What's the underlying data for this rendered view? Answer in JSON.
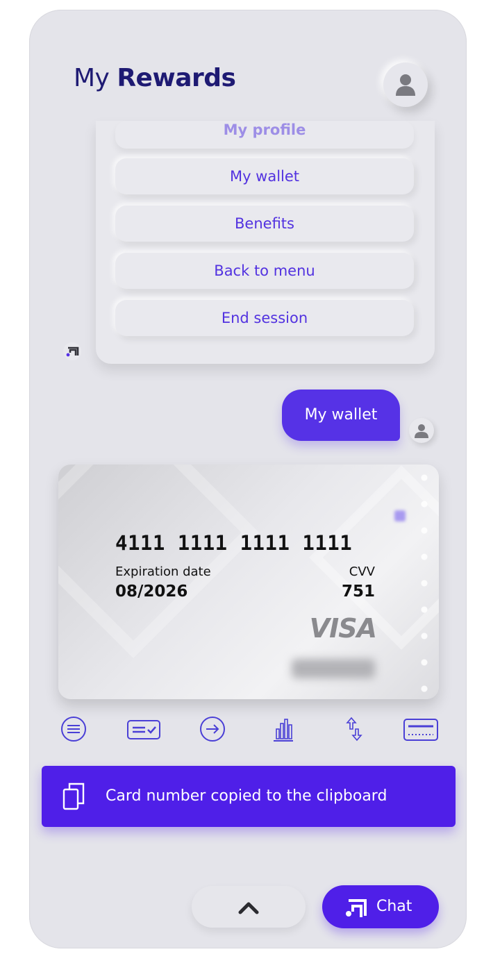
{
  "header": {
    "title_light": "My",
    "title_bold": "Rewards"
  },
  "menu": {
    "items": [
      {
        "label": "My profile"
      },
      {
        "label": "My wallet"
      },
      {
        "label": "Benefits"
      },
      {
        "label": "Back to menu"
      },
      {
        "label": "End session"
      }
    ]
  },
  "chat": {
    "user_message": "My wallet"
  },
  "card": {
    "number": "4111 1111 1111 1111",
    "exp_label": "Expiration date",
    "exp_value": "08/2026",
    "cvv_label": "CVV",
    "cvv_value": "751",
    "brand": "VISA"
  },
  "toolbar": {
    "icons": [
      "menu-lines-icon",
      "card-check-icon",
      "arrow-right-circle-icon",
      "bar-chart-icon",
      "transfer-arrows-icon",
      "card-icon"
    ]
  },
  "toast": {
    "message": "Card number copied to the clipboard"
  },
  "footer": {
    "chat_label": "Chat"
  },
  "colors": {
    "accent": "#4f1fe8",
    "title": "#1e1a73",
    "menu_text": "#5232e0",
    "background": "#e4e4ea"
  }
}
